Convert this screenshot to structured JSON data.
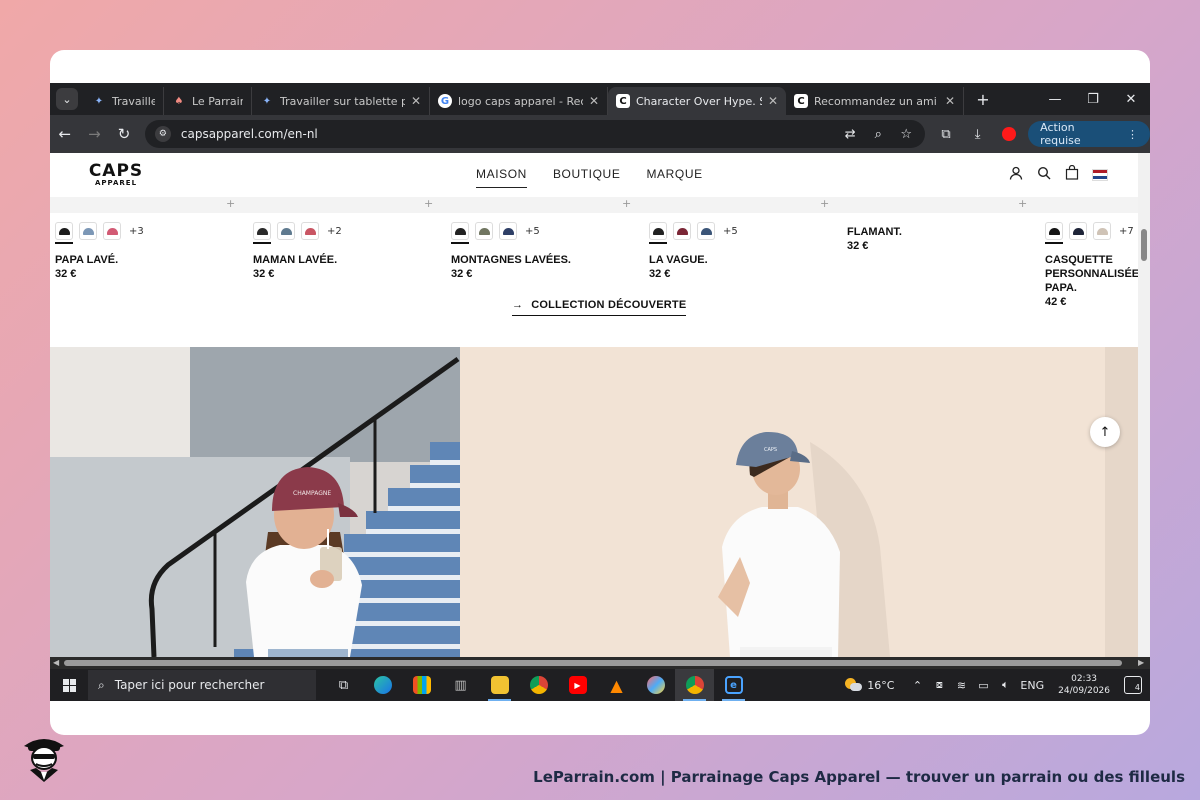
{
  "browser": {
    "tabs": [
      {
        "title": "Travailler sur",
        "fav": "gemini",
        "active": false
      },
      {
        "title": "Le Parrain -",
        "fav": "parrain",
        "active": false
      },
      {
        "title": "Travailler sur tablette pour ch",
        "fav": "gemini",
        "active": false
      },
      {
        "title": "logo caps apparel - Recherch",
        "fav": "google",
        "active": false
      },
      {
        "title": "Character Over Hype. Since",
        "fav": "caps",
        "active": true
      },
      {
        "title": "Recommandez un ami - Vête",
        "fav": "caps",
        "active": false
      }
    ],
    "url": "capsapparel.com/en-nl",
    "action_button": "Action requise"
  },
  "site": {
    "logo_top": "CAPS",
    "logo_bottom": "APPAREL",
    "nav": [
      {
        "label": "MAISON",
        "active": true
      },
      {
        "label": "BOUTIQUE",
        "active": false
      },
      {
        "label": "MARQUE",
        "active": false
      }
    ],
    "products": [
      {
        "name": "PAPA LAVÉ.",
        "price": "32 €",
        "more": "+3",
        "swatches": [
          "#1c1c1c",
          "#7c97b6",
          "#d25a74"
        ]
      },
      {
        "name": "MAMAN LAVÉE.",
        "price": "32 €",
        "more": "+2",
        "swatches": [
          "#2a2a2a",
          "#5f7a8f",
          "#c95563"
        ]
      },
      {
        "name": "MONTAGNES LAVÉES.",
        "price": "32 €",
        "more": "+5",
        "swatches": [
          "#222222",
          "#707560",
          "#2e3f66"
        ]
      },
      {
        "name": "LA VAGUE.",
        "price": "32 €",
        "more": "+5",
        "swatches": [
          "#222222",
          "#7b2636",
          "#3b5578"
        ]
      },
      {
        "name": "FLAMANT.",
        "price": "32 €",
        "more": "",
        "swatches": []
      },
      {
        "name": "CASQUETTE PERSONNALISÉE POUR PAPA.",
        "price": "42 €",
        "more": "+7",
        "swatches": [
          "#151515",
          "#1e2438",
          "#cfc3b6"
        ]
      }
    ],
    "collection_link": "COLLECTION DÉCOUVERTE",
    "hero_cap_text": "CHAMPAGNE"
  },
  "taskbar": {
    "search_placeholder": "Taper ici pour rechercher",
    "weather": "16°C",
    "lang": "ENG",
    "time": "02:33",
    "date": "24/09/2026",
    "notifications": "4"
  },
  "footer": {
    "caption": "LeParrain.com | Parrainage Caps Apparel — trouver un parrain ou des filleuls"
  },
  "colors": {
    "chrome_dark": "#202124",
    "toolbar": "#35363a",
    "action_blue": "#1a4f78",
    "hero_wall": "#f2e3d5",
    "stairs_blue": "#5f86b6"
  }
}
